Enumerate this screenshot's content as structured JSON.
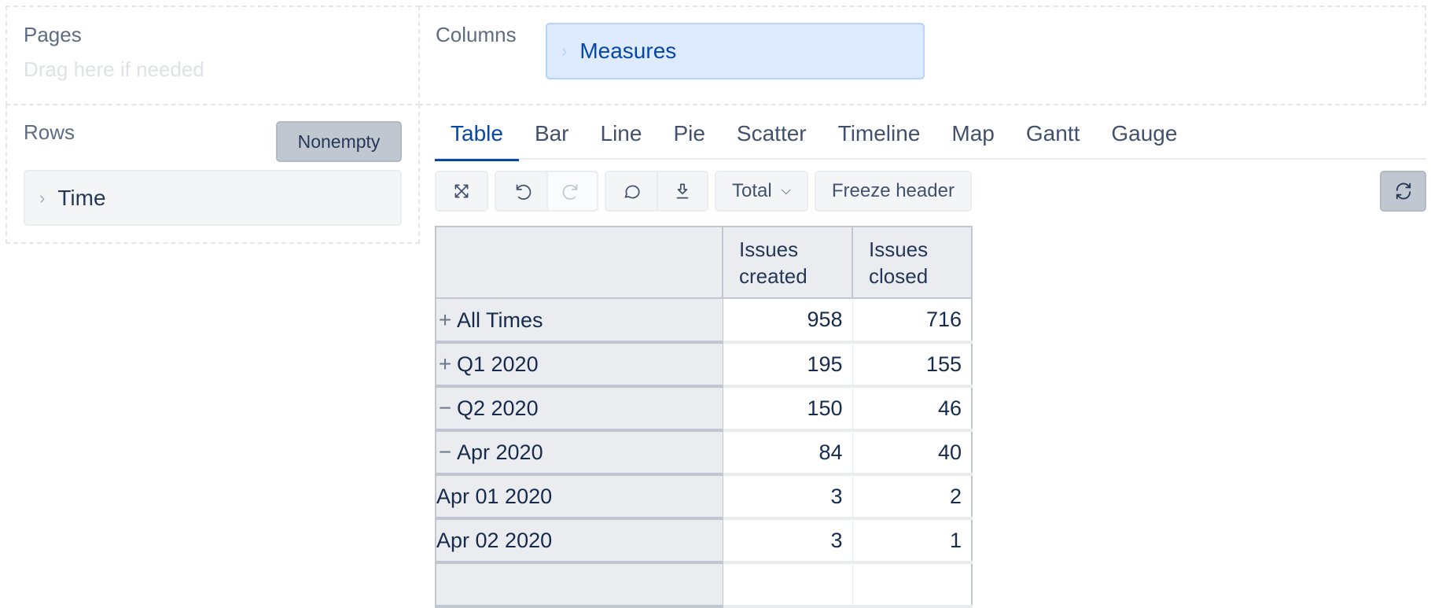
{
  "pages": {
    "title": "Pages",
    "hint": "Drag here if needed"
  },
  "rows": {
    "title": "Rows",
    "nonempty_label": "Nonempty",
    "dimension": "Time"
  },
  "columns": {
    "title": "Columns",
    "dimension": "Measures"
  },
  "tabs": [
    {
      "label": "Table",
      "active": true
    },
    {
      "label": "Bar"
    },
    {
      "label": "Line"
    },
    {
      "label": "Pie"
    },
    {
      "label": "Scatter"
    },
    {
      "label": "Timeline"
    },
    {
      "label": "Map"
    },
    {
      "label": "Gantt"
    },
    {
      "label": "Gauge"
    }
  ],
  "toolbar": {
    "total_label": "Total",
    "freeze_label": "Freeze header",
    "icons": [
      "fullscreen-icon",
      "undo-icon",
      "redo-icon",
      "comment-icon",
      "download-icon",
      "refresh-icon"
    ]
  },
  "table": {
    "columns": [
      "Issues created",
      "Issues closed"
    ],
    "rows": [
      {
        "label": "All Times",
        "level": 0,
        "expander": "+",
        "values": [
          "958",
          "716"
        ]
      },
      {
        "label": "Q1 2020",
        "level": 1,
        "expander": "+",
        "values": [
          "195",
          "155"
        ]
      },
      {
        "label": "Q2 2020",
        "level": 1,
        "expander": "−",
        "values": [
          "150",
          "46"
        ]
      },
      {
        "label": "Apr 2020",
        "level": 2,
        "expander": "−",
        "values": [
          "84",
          "40"
        ]
      },
      {
        "label": "Apr 01 2020",
        "level": 3,
        "expander": "",
        "values": [
          "3",
          "2"
        ]
      },
      {
        "label": "Apr 02 2020",
        "level": 3,
        "expander": "",
        "values": [
          "3",
          "1"
        ]
      },
      {
        "label": "",
        "level": 3,
        "expander": "",
        "values": [
          "",
          ""
        ]
      }
    ]
  }
}
